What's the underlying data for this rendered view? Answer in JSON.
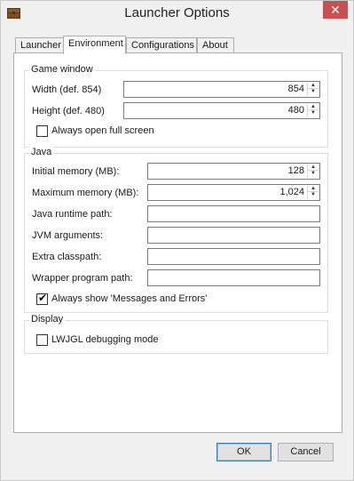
{
  "window": {
    "title": "Launcher Options",
    "close_glyph": "✕",
    "app_icon": "minecraft-chest-icon"
  },
  "tabs": [
    {
      "label": "Launcher",
      "active": false
    },
    {
      "label": "Environment",
      "active": true
    },
    {
      "label": "Configurations",
      "active": false
    },
    {
      "label": "About",
      "active": false
    }
  ],
  "game_window": {
    "legend": "Game window",
    "width_label": "Width (def. 854)",
    "width_value": "854",
    "height_label": "Height (def. 480)",
    "height_value": "480",
    "fullscreen_label": "Always open full screen",
    "fullscreen_checked": false
  },
  "java": {
    "legend": "Java",
    "initial_memory_label": "Initial memory (MB):",
    "initial_memory_value": "128",
    "max_memory_label": "Maximum memory (MB):",
    "max_memory_value": "1,024",
    "runtime_label": "Java runtime path:",
    "runtime_value": "",
    "jvm_args_label": "JVM arguments:",
    "jvm_args_value": "",
    "classpath_label": "Extra classpath:",
    "classpath_value": "",
    "wrapper_label": "Wrapper program path:",
    "wrapper_value": "",
    "show_messages_label": "Always show 'Messages and Errors'",
    "show_messages_checked": true
  },
  "display": {
    "legend": "Display",
    "lwjgl_label": "LWJGL debugging mode",
    "lwjgl_checked": false
  },
  "buttons": {
    "ok": "OK",
    "cancel": "Cancel"
  },
  "colors": {
    "close_button": "#c75050",
    "accent": "#3c7fb1"
  }
}
